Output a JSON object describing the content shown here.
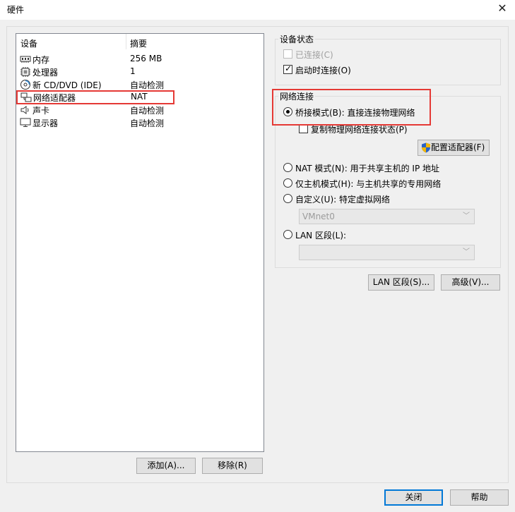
{
  "window": {
    "title": "硬件",
    "close_glyph": "✕"
  },
  "devices": {
    "columns": {
      "device": "设备",
      "summary": "摘要"
    },
    "items": [
      {
        "name": "内存",
        "summary": "256 MB",
        "icon": "memory-icon"
      },
      {
        "name": "处理器",
        "summary": "1",
        "icon": "processor-icon"
      },
      {
        "name": "新 CD/DVD (IDE)",
        "summary": "自动检测",
        "icon": "cdrom-icon"
      },
      {
        "name": "网络适配器",
        "summary": "NAT",
        "icon": "network-adapter-icon",
        "selected": true
      },
      {
        "name": "声卡",
        "summary": "自动检测",
        "icon": "sound-icon"
      },
      {
        "name": "显示器",
        "summary": "自动检测",
        "icon": "display-icon"
      }
    ],
    "add_label": "添加(A)...",
    "remove_label": "移除(R)"
  },
  "device_status": {
    "title": "设备状态",
    "connected_label": "已连接(C)",
    "connected_checked": false,
    "connected_enabled": false,
    "connect_at_power_on_label": "启动时连接(O)",
    "connect_at_power_on_checked": true
  },
  "network": {
    "title": "网络连接",
    "bridged_label": "桥接模式(B): 直接连接物理网络",
    "replicate_label": "复制物理网络连接状态(P)",
    "configure_adapters_label": "配置适配器(F)",
    "nat_label": "NAT 模式(N): 用于共享主机的 IP 地址",
    "hostonly_label": "仅主机模式(H): 与主机共享的专用网络",
    "custom_label": "自定义(U): 特定虚拟网络",
    "custom_value": "VMnet0",
    "lan_segment_label": "LAN 区段(L):",
    "lan_segment_value": "",
    "selected_mode": "bridged"
  },
  "actions": {
    "lan_segments_label": "LAN 区段(S)...",
    "advanced_label": "高级(V)..."
  },
  "footer": {
    "close_label": "关闭",
    "help_label": "帮助"
  },
  "colors": {
    "highlight": "#e53935",
    "accent": "#0078d7"
  }
}
